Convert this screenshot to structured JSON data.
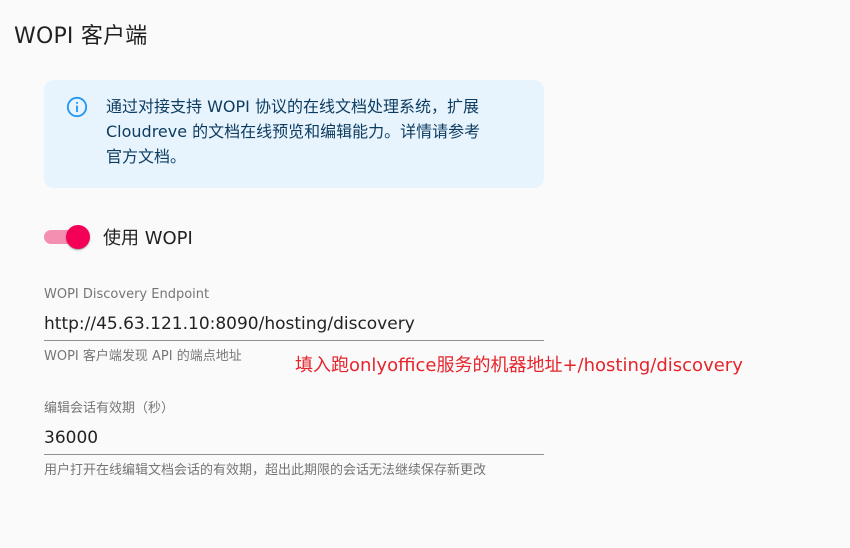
{
  "section": {
    "title": "WOPI 客户端"
  },
  "alert": {
    "icon": "info-icon",
    "color": "#2196f3",
    "text": "通过对接支持 WOPI 协议的在线文档处理系统，扩展 Cloudreve 的文档在线预览和编辑能力。详情请参考",
    "link_text": "官方文档",
    "link_suffix": "。"
  },
  "enable_wopi": {
    "label": "使用 WOPI",
    "checked": true,
    "accent": "#f50057"
  },
  "discovery_endpoint": {
    "label": "WOPI Discovery Endpoint",
    "value": "http://45.63.121.10:8090/hosting/discovery",
    "help": "WOPI 客户端发现 API 的端点地址"
  },
  "annotation": {
    "text": "填入跑onlyoffice服务的机器地址+/hosting/discovery",
    "color": "#e5242b"
  },
  "session_ttl": {
    "label": "编辑会话有效期（秒）",
    "value": "36000",
    "help": "用户打开在线编辑文档会话的有效期，超出此期限的会话无法继续保存新更改"
  }
}
